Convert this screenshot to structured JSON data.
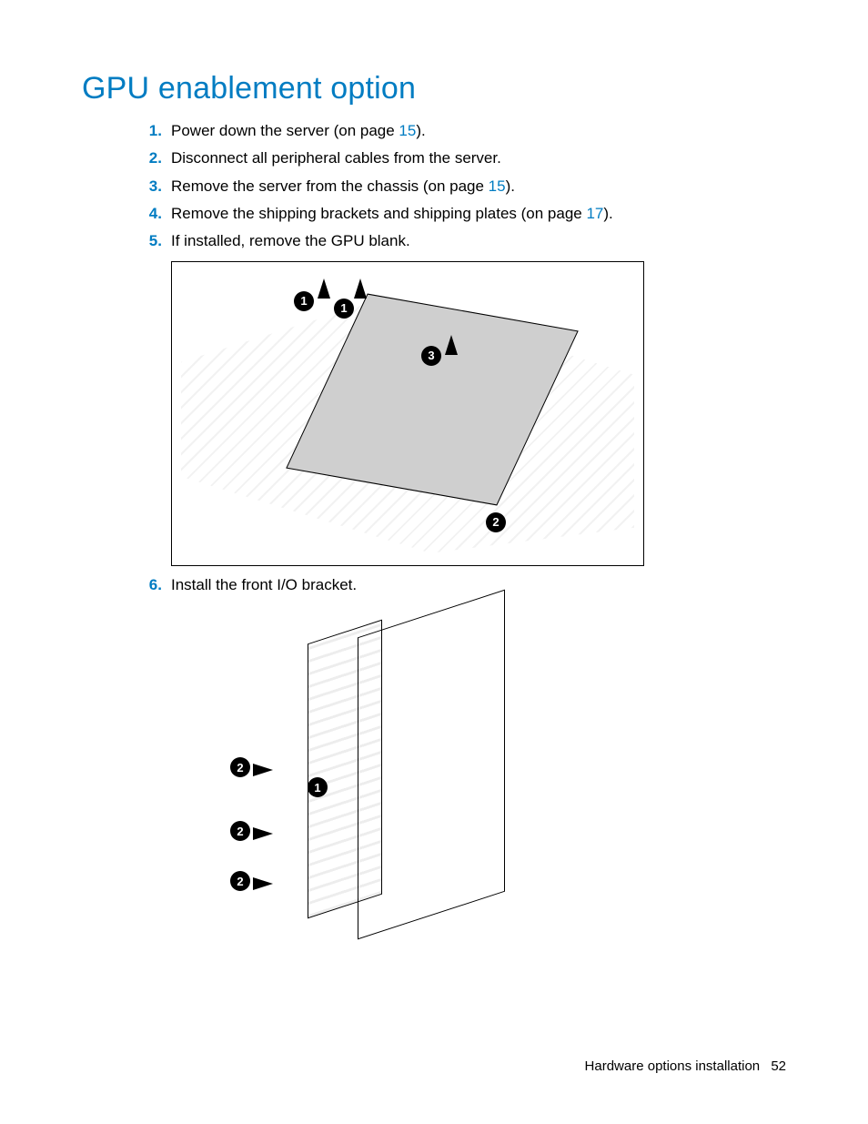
{
  "section": {
    "heading": "GPU enablement option"
  },
  "steps": [
    {
      "pre": "Power down the server (on page ",
      "link": "15",
      "post": ")."
    },
    {
      "pre": "Disconnect all peripheral cables from the server.",
      "link": "",
      "post": ""
    },
    {
      "pre": "Remove the server from the chassis (on page ",
      "link": "15",
      "post": ")."
    },
    {
      "pre": "Remove the shipping brackets and shipping plates (on page ",
      "link": "17",
      "post": ")."
    },
    {
      "pre": "If installed, remove the GPU blank.",
      "link": "",
      "post": ""
    },
    {
      "pre": "Install the front I/O bracket.",
      "link": "",
      "post": ""
    }
  ],
  "figure1": {
    "callouts": [
      "1",
      "1",
      "3",
      "2"
    ]
  },
  "figure2": {
    "callouts": [
      "2",
      "1",
      "2",
      "2"
    ]
  },
  "footer": {
    "section_name": "Hardware options installation",
    "page_number": "52"
  }
}
